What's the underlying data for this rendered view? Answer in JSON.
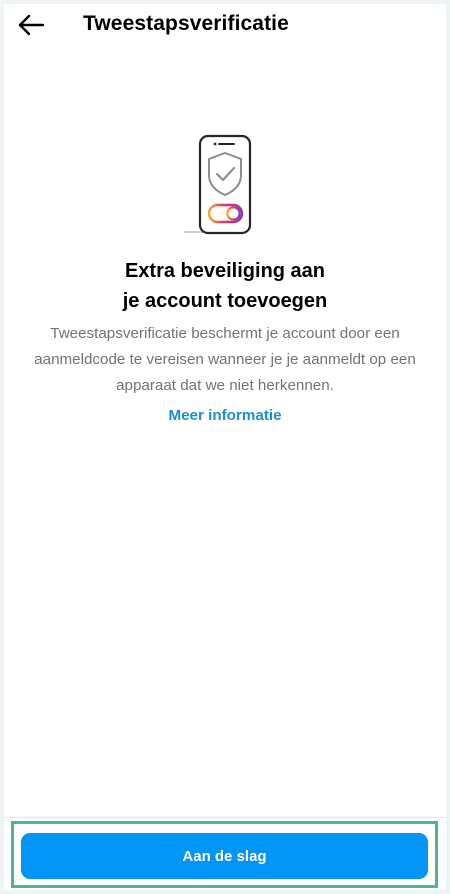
{
  "header": {
    "back_icon": "arrow-left-icon",
    "title": "Tweestapsverificatie"
  },
  "illustration": {
    "icon": "phone-shield-check-icon",
    "colors": {
      "outline": "#262626",
      "shield": "#8e8e8e",
      "toggle_gradient": [
        "#f9a825",
        "#e1306c",
        "#833ab4"
      ]
    }
  },
  "content": {
    "headline_line1": "Extra beveiliging aan",
    "headline_line2": "je account toevoegen",
    "description": "Tweestapsverificatie beschermt je account door een aanmeldcode te vereisen wanneer je je aanmeldt op een apparaat dat we niet herkennen.",
    "more_link": "Meer informatie"
  },
  "footer": {
    "cta_label": "Aan de slag"
  },
  "colors": {
    "accent": "#0095f6",
    "link": "#1b8fd2",
    "highlight_frame": "#52b48f"
  }
}
